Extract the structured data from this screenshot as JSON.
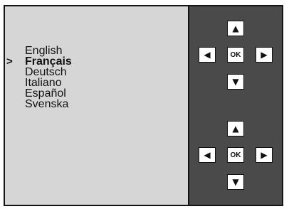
{
  "language_menu": {
    "cursor": ">",
    "items": [
      {
        "label": "English",
        "selected": false
      },
      {
        "label": "Français",
        "selected": true
      },
      {
        "label": "Deutsch",
        "selected": false
      },
      {
        "label": "Italiano",
        "selected": false
      },
      {
        "label": "Español",
        "selected": false
      },
      {
        "label": "Svenska",
        "selected": false
      }
    ]
  },
  "keypad": {
    "up_icon": "▲",
    "down_icon": "▼",
    "left_icon": "◀",
    "right_icon": "▶",
    "ok_label": "OK"
  },
  "colors": {
    "menu_background": "#d6d6d6",
    "panel_background": "#4a4a4a",
    "key_background": "#ffffff"
  }
}
